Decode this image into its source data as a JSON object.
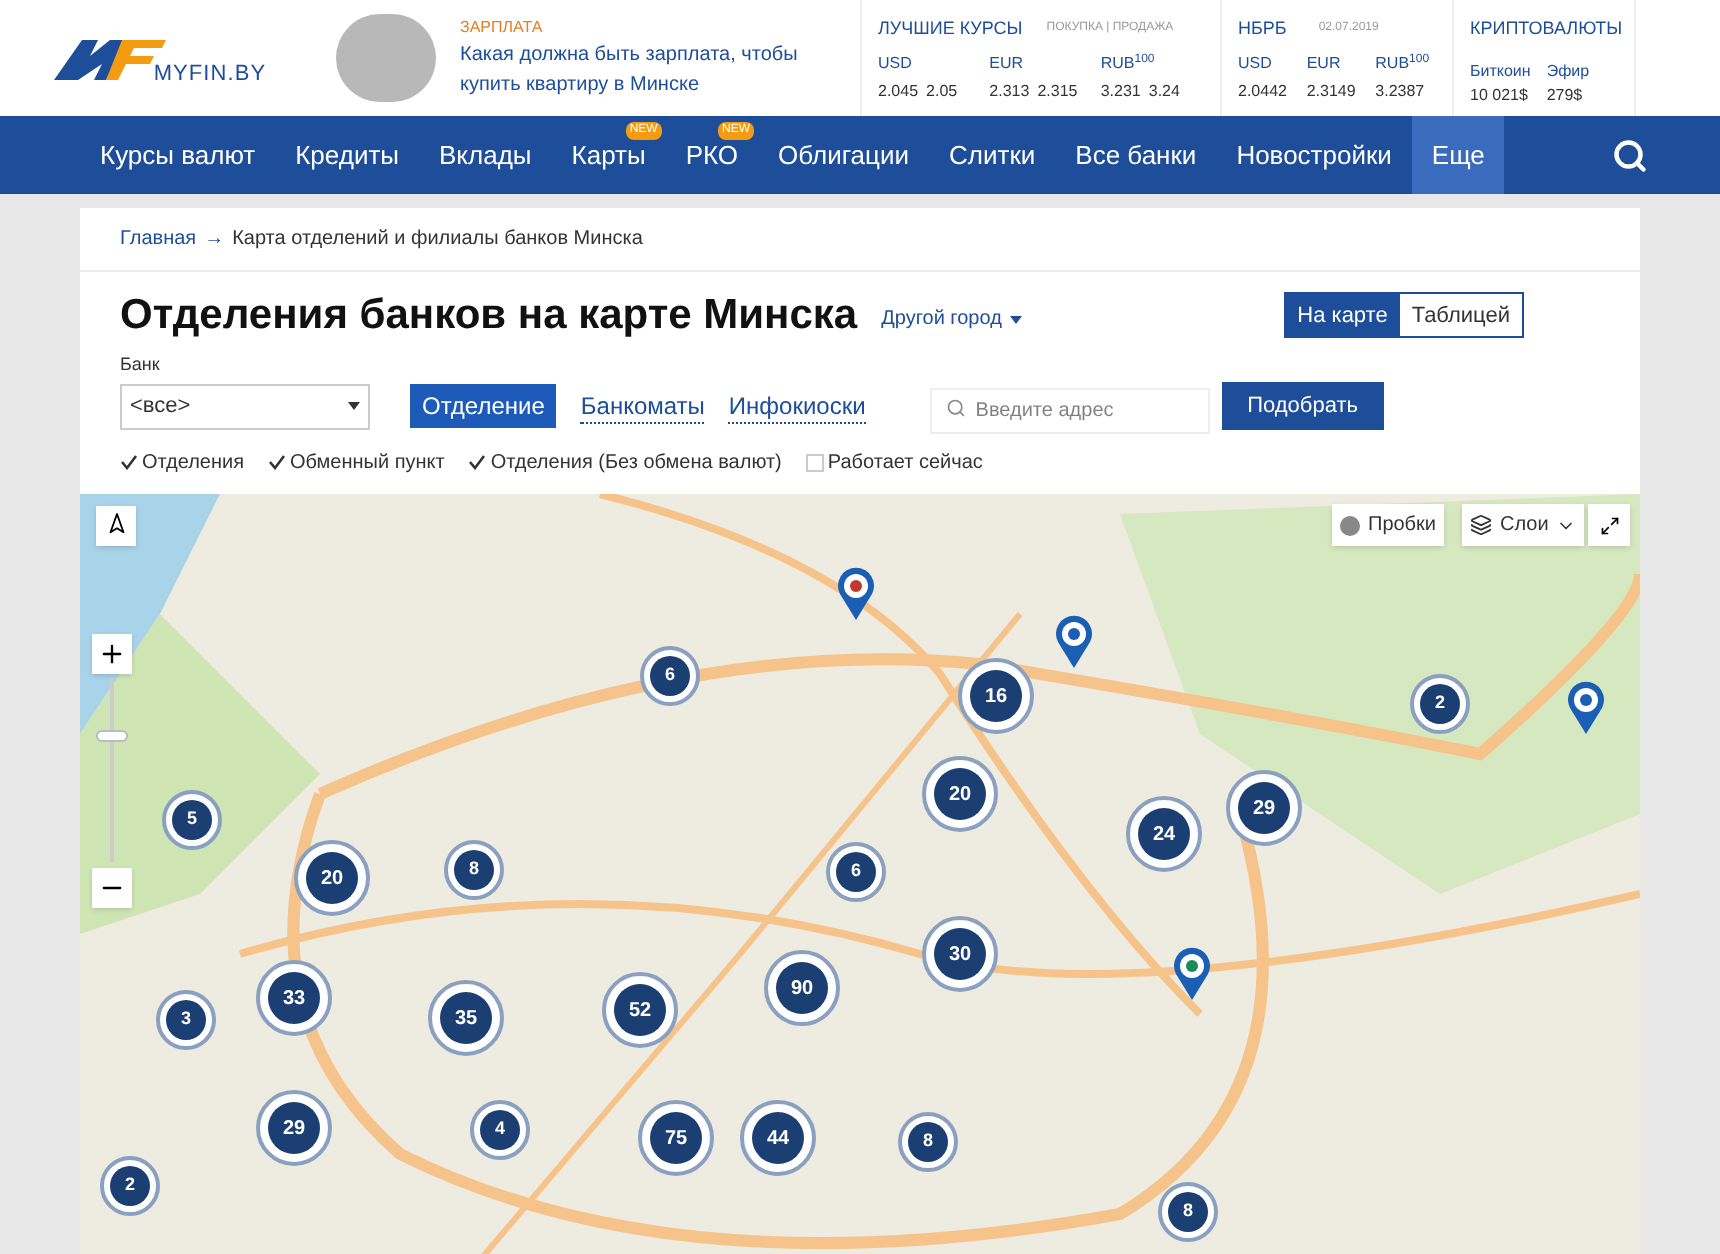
{
  "header": {
    "logo": "MYFIN.BY",
    "news": {
      "category": "ЗАРПЛАТА",
      "title": "Какая должна быть зарплата, чтобы купить квартиру в Минске"
    },
    "best_rates": {
      "title": "ЛУЧШИЕ КУРСЫ",
      "subtitle": "ПОКУПКА | ПРОДАЖА",
      "currencies": [
        {
          "code": "USD",
          "buy": "2.045",
          "sell": "2.05"
        },
        {
          "code": "EUR",
          "buy": "2.313",
          "sell": "2.315"
        },
        {
          "code": "RUB$^{100}$",
          "buy": "3.231",
          "sell": "3.24"
        }
      ]
    },
    "nbrb": {
      "title": "НБРБ",
      "date": "02.07.2019",
      "currencies": [
        {
          "code": "USD",
          "rate": "2.0442"
        },
        {
          "code": "EUR",
          "rate": "2.3149"
        },
        {
          "code": "RUB$^{100}$",
          "rate": "3.2387"
        }
      ]
    },
    "crypto": {
      "title": "КРИПТОВАЛЮТЫ",
      "coins": [
        {
          "name": "Биткоин",
          "price": "10 021$"
        },
        {
          "name": "Эфир",
          "price": "279$"
        }
      ]
    }
  },
  "nav": [
    {
      "label": "Курсы валют",
      "selected": false
    },
    {
      "label": "Кредиты",
      "selected": false
    },
    {
      "label": "Вклады",
      "selected": false
    },
    {
      "label": "Карты",
      "badge": "NEW",
      "selected": false
    },
    {
      "label": "РКО",
      "badge": "NEW",
      "selected": false
    },
    {
      "label": "Облигации",
      "selected": false
    },
    {
      "label": "Слитки",
      "selected": false
    },
    {
      "label": "Все банки",
      "selected": false
    },
    {
      "label": "Новостройки",
      "selected": false
    },
    {
      "label": "Еще",
      "selected": true
    }
  ],
  "breadcrumb": [
    "Главная",
    "→",
    "Карта отделений и филиалы банков Минска"
  ],
  "title": "Отделения банков на карте Минска",
  "city_link": "Другой город",
  "view_toggle": [
    {
      "label": "На карте",
      "selected": true
    },
    {
      "label": "Таблицей",
      "selected": false
    }
  ],
  "bank_select": {
    "label": "Банк",
    "value": "<все>"
  },
  "tabs": [
    {
      "label": "Отделение",
      "selected": true
    },
    {
      "label": "Банкоматы",
      "selected": false
    },
    {
      "label": "Инфокиоски",
      "selected": false
    }
  ],
  "address": {
    "placeholder": "Введите адрес"
  },
  "submit": "Подобрать",
  "filters": [
    {
      "label": "Отделения",
      "checked": true
    },
    {
      "label": "Обменный пункт",
      "checked": true
    },
    {
      "label": "Отделения (Без обмена валют)",
      "checked": true
    },
    {
      "label": "Работает сейчас",
      "checked": false
    }
  ],
  "map": {
    "traffic": "Пробки",
    "layers": "Слои",
    "zoom": {
      "level": 0.7
    },
    "clusters": [
      "6",
      "16",
      "2",
      "20",
      "5",
      "8",
      "20",
      "6",
      "24",
      "29",
      "30",
      "90",
      "33",
      "35",
      "52",
      "3",
      "29",
      "4",
      "75",
      "44",
      "8",
      "2",
      "8"
    ]
  }
}
